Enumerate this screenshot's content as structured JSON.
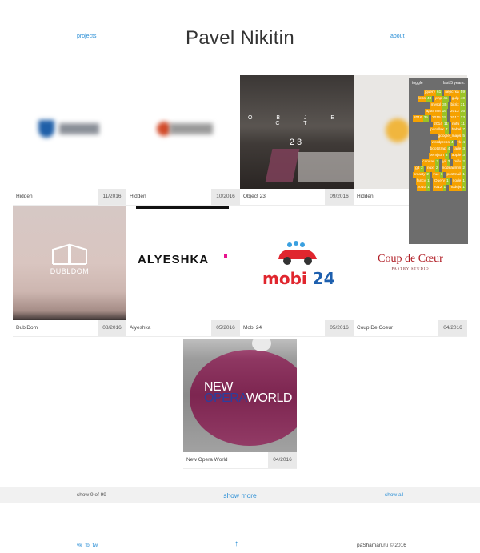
{
  "header": {
    "title": "Pavel Nikitin",
    "projects_link": "projects",
    "about_link": "about"
  },
  "projects": [
    {
      "name": "Hidden",
      "date": "11/2016"
    },
    {
      "name": "Hidden",
      "date": "10/2016"
    },
    {
      "name": "Object 23",
      "date": "09/2016",
      "thumb_text": "O B J E C T",
      "thumb_number": "23"
    },
    {
      "name": "Hidden",
      "date": ""
    },
    {
      "name": "DublDom",
      "date": "08/2016",
      "thumb_text": "DUBLDOM"
    },
    {
      "name": "Alyeshka",
      "date": "05/2016",
      "thumb_text": "ALYESHKA"
    },
    {
      "name": "Mobi 24",
      "date": "05/2016",
      "thumb_text_a": "mobi",
      "thumb_text_b": "24"
    },
    {
      "name": "Coup De Coeur",
      "date": "04/2016",
      "thumb_text": "Coup de Cœur",
      "thumb_sub": "PASTRY STUDIO"
    },
    {
      "name": "New Opera World",
      "date": "04/2016",
      "thumb_text_1": "NEW",
      "thumb_text_2a": "OPERA",
      "thumb_text_2b": "WORLD"
    }
  ],
  "panel": {
    "toggle_label": "toggle",
    "period_label": "last 5 years:",
    "tags": [
      {
        "label": "jquery",
        "count": "61"
      },
      {
        "label": "верстка",
        "count": "59"
      },
      {
        "label": "less",
        "count": "48"
      },
      {
        "label": "php",
        "count": "45"
      },
      {
        "label": "gulp",
        "count": "40"
      },
      {
        "label": "mysql",
        "count": "35"
      },
      {
        "label": "bitrix",
        "count": "31"
      },
      {
        "label": "адаптив",
        "count": "16"
      },
      {
        "label": "2013",
        "count": "16"
      },
      {
        "label": "2016",
        "count": "35"
      },
      {
        "label": "2015",
        "count": "15"
      },
      {
        "label": "2017",
        "count": "13"
      },
      {
        "label": "2014",
        "count": "11"
      },
      {
        "label": "mifu",
        "count": "11"
      },
      {
        "label": "parallax",
        "count": "7"
      },
      {
        "label": "babel",
        "count": "7"
      },
      {
        "label": "google_maps",
        "count": "5"
      },
      {
        "label": "wordpress",
        "count": "4"
      },
      {
        "label": "vk",
        "count": "4"
      },
      {
        "label": "bootstrap",
        "count": "4"
      },
      {
        "label": "jade",
        "count": "3"
      },
      {
        "label": "bemjson",
        "count": "3"
      },
      {
        "label": "apple",
        "count": "3"
      },
      {
        "label": "canvas",
        "count": "2"
      },
      {
        "label": "yii",
        "count": "2"
      },
      {
        "label": "mifu",
        "count": "2"
      },
      {
        "label": "git",
        "count": "2"
      },
      {
        "label": "nuxt",
        "count": "2"
      },
      {
        "label": "nodeadmin",
        "count": "2"
      },
      {
        "label": "smarty",
        "count": "2"
      },
      {
        "label": "vue",
        "count": "1"
      },
      {
        "label": "postmail",
        "count": "1"
      },
      {
        "label": "fancy",
        "count": "1"
      },
      {
        "label": "jQuery",
        "count": "1"
      },
      {
        "label": "node",
        "count": "1"
      },
      {
        "label": "2010",
        "count": "1"
      },
      {
        "label": "2012",
        "count": "1"
      },
      {
        "label": "nodejs",
        "count": "1"
      }
    ]
  },
  "footer": {
    "show_count": "show 9 of 99",
    "show_more": "show more",
    "show_all": "show all",
    "social": [
      "vk",
      "fb",
      "tw"
    ],
    "up_arrow": "↑",
    "copyright": "paShaman.ru © 2016"
  },
  "colors": {
    "link": "#2b8fd6",
    "tag_count": "#9ac325",
    "tag_label": "#f5a100",
    "panel_bg": "#6d6d6d",
    "coup_red": "#b01d25",
    "mobi_red": "#e0262e",
    "mobi_blue": "#1d5fae",
    "opera_pink": "#e2207f"
  }
}
